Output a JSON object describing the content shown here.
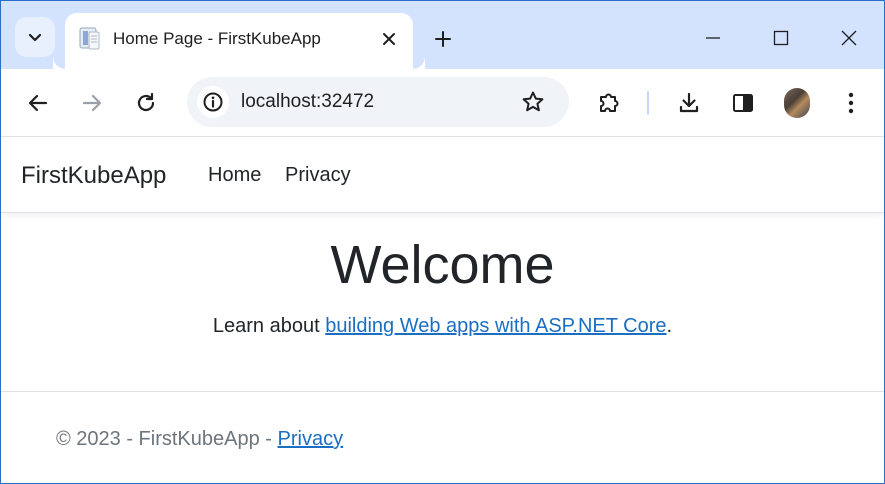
{
  "browser": {
    "tab": {
      "title": "Home Page - FirstKubeApp",
      "favicon": "page-favicon-icon"
    },
    "toolbar": {
      "url": "localhost:32472"
    },
    "colors": {
      "tabstrip": "#d3e3fd",
      "omnibox": "#f0f4f9",
      "frame_border": "#2b6fc5"
    }
  },
  "site": {
    "brand": "FirstKubeApp",
    "nav": [
      {
        "label": "Home"
      },
      {
        "label": "Privacy"
      }
    ],
    "main": {
      "heading": "Welcome",
      "learn_prefix": "Learn about ",
      "learn_link": "building Web apps with ASP.NET Core",
      "learn_suffix": "."
    },
    "footer": {
      "text": "© 2023 - FirstKubeApp - ",
      "link": "Privacy"
    },
    "colors": {
      "link": "#1b6ec2",
      "text": "#212529",
      "muted": "#6c757d"
    }
  }
}
